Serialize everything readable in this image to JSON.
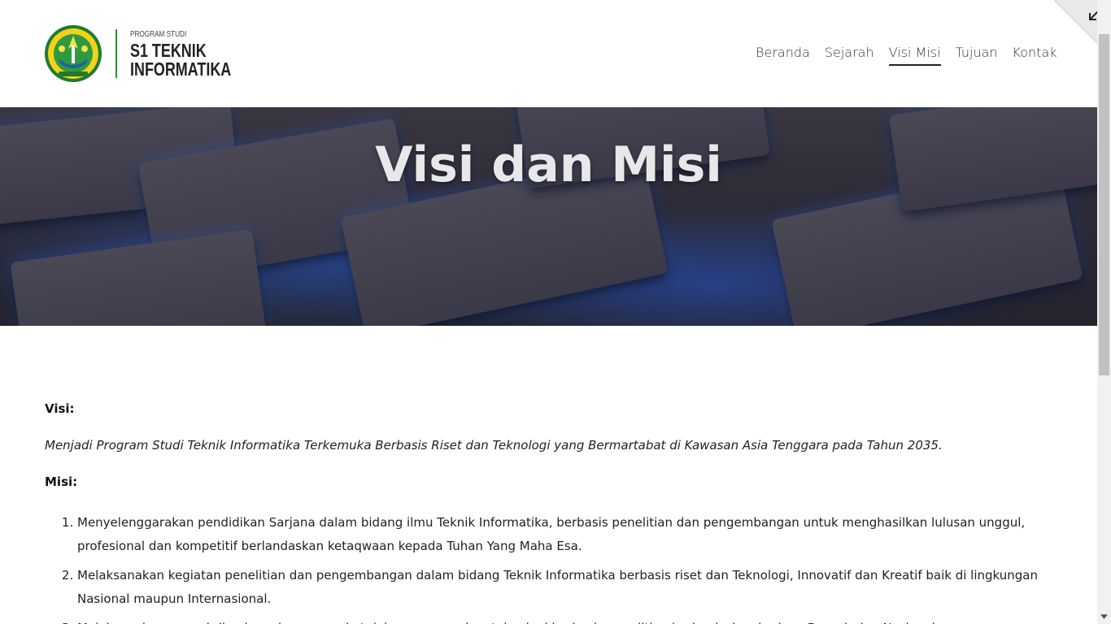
{
  "header": {
    "brand_small": "PROGRAM STUDI",
    "brand_line1": "S1 TEKNIK",
    "brand_line2": "INFORMATIKA"
  },
  "nav": {
    "items": [
      {
        "label": "Beranda"
      },
      {
        "label": "Sejarah"
      },
      {
        "label": "Visi Misi",
        "active": true
      },
      {
        "label": "Tujuan"
      },
      {
        "label": "Kontak"
      }
    ]
  },
  "hero": {
    "title": "Visi dan Misi"
  },
  "content": {
    "visi_label": "Visi:",
    "visi_text": "Menjadi Program Studi Teknik Informatika Terkemuka Berbasis Riset dan Teknologi yang Bermartabat di Kawasan Asia Tenggara pada Tahun 2035.",
    "misi_label": "Misi:",
    "misi_items": [
      "Menyelenggarakan pendidikan Sarjana dalam bidang ilmu Teknik Informatika, berbasis penelitian dan pengembangan untuk menghasilkan lulusan unggul, profesional dan kompetitif berlandaskan ketaqwaan kepada Tuhan Yang Maha Esa.",
      "Melaksanakan kegiatan penelitian dan pengembangan dalam bidang Teknik Informatika berbasis riset  dan Teknologi, Innovatif dan Kreatif baik di lingkungan Nasional maupun Internasional.",
      "Melaksanakan pengabdian kepada masyarakat dalam menerapkan teknologi berbasis penelitian berlandaskan budaya Daerah dan Nasional."
    ]
  },
  "icons": {
    "corner": "collapse-arrow-icon",
    "logo": "university-emblem-icon"
  },
  "colors": {
    "brand_green": "#2e8b3d",
    "logo_yellow": "#f2d21b"
  }
}
